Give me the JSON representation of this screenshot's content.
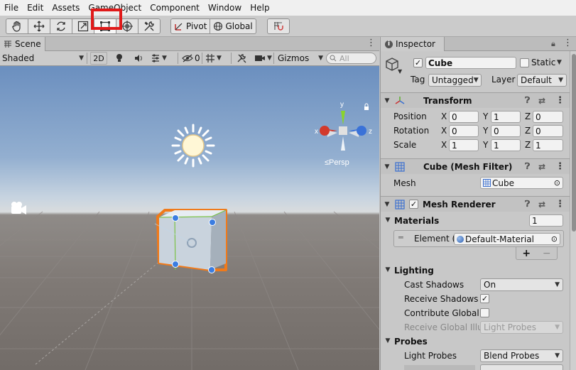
{
  "menu": [
    "File",
    "Edit",
    "Assets",
    "GameObject",
    "Component",
    "Window",
    "Help"
  ],
  "toolbar": {
    "tools": [
      {
        "name": "hand-tool-icon"
      },
      {
        "name": "move-tool-icon"
      },
      {
        "name": "rotate-tool-icon"
      },
      {
        "name": "scale-tool-icon"
      },
      {
        "name": "rect-tool-icon"
      },
      {
        "name": "transform-tool-icon"
      },
      {
        "name": "custom-tool-icon"
      }
    ],
    "pivot_label": "Pivot",
    "global_label": "Global"
  },
  "scene": {
    "tab_label": "Scene",
    "shading_mode": "Shaded",
    "two_d_label": "2D",
    "hidden_count": "0",
    "gizmos_label": "Gizmos",
    "search_placeholder": "All",
    "gizmo": {
      "y": "y",
      "x": "x",
      "z": "z",
      "persp": "≤Persp"
    }
  },
  "inspector": {
    "tab_label": "Inspector",
    "object_name": "Cube",
    "static_label": "Static",
    "tag_label": "Tag",
    "tag_value": "Untagged",
    "layer_label": "Layer",
    "layer_value": "Default",
    "transform": {
      "title": "Transform",
      "position_label": "Position",
      "rotation_label": "Rotation",
      "scale_label": "Scale",
      "position": {
        "x": "0",
        "y": "1",
        "z": "0"
      },
      "rotation": {
        "x": "0",
        "y": "0",
        "z": "0"
      },
      "scale": {
        "x": "1",
        "y": "1",
        "z": "1"
      },
      "axis_x": "X",
      "axis_y": "Y",
      "axis_z": "Z"
    },
    "mesh_filter": {
      "title": "Cube (Mesh Filter)",
      "mesh_label": "Mesh",
      "mesh_value": "Cube"
    },
    "mesh_renderer": {
      "title": "Mesh Renderer",
      "materials_label": "Materials",
      "materials_count": "1",
      "element_label": "Element (",
      "element_value": "Default-Material",
      "add": "+",
      "remove": "−",
      "lighting_label": "Lighting",
      "cast_shadows_label": "Cast Shadows",
      "cast_shadows_value": "On",
      "receive_shadows_label": "Receive Shadows",
      "contribute_gi_label": "Contribute Global I",
      "receive_gi_label": "Receive Global Illu",
      "receive_gi_value": "Light Probes",
      "probes_label": "Probes",
      "light_probes_label": "Light Probes",
      "light_probes_value": "Blend Probes"
    }
  },
  "colors": {
    "highlight": "#e01a1a",
    "selection_outline": "#f07a1a",
    "axis_x": "#d33a2c",
    "axis_y": "#8ad42c",
    "axis_z": "#3a72d8"
  }
}
